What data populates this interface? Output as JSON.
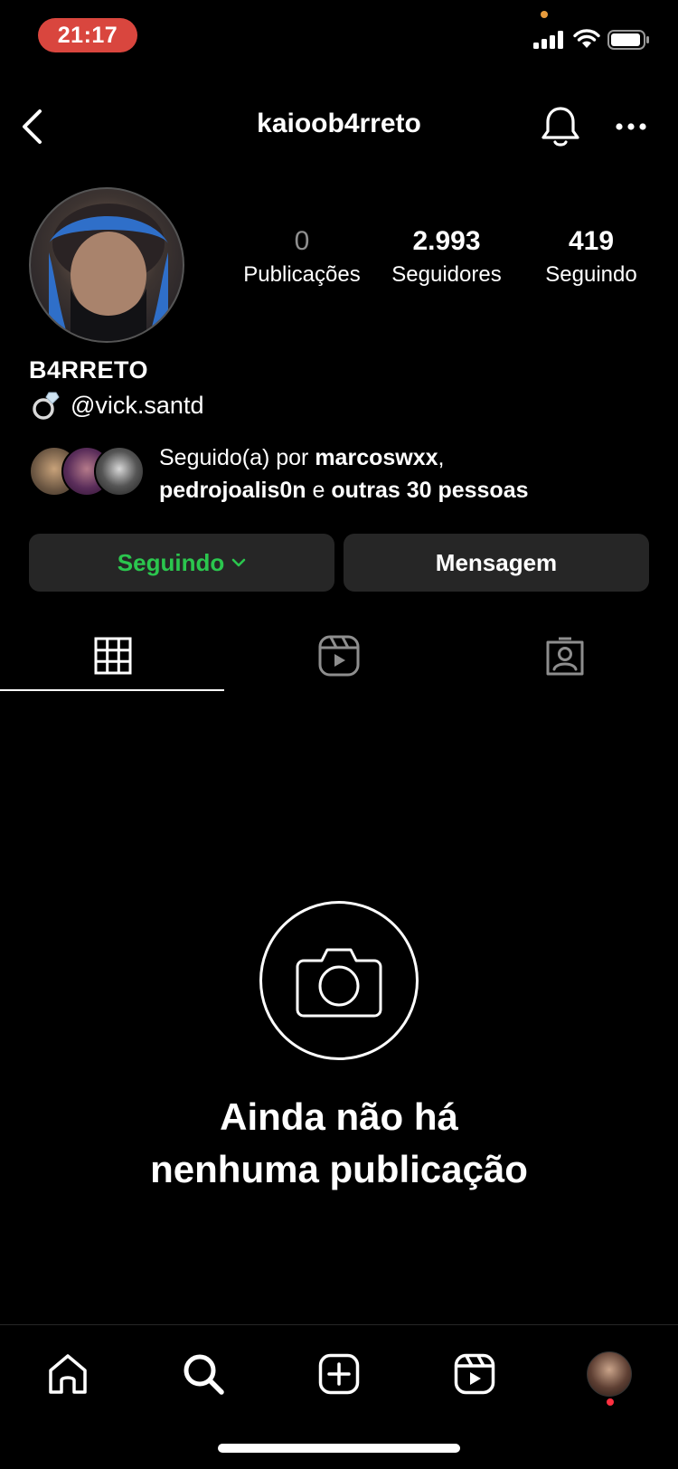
{
  "status_bar": {
    "time": "21:17"
  },
  "header": {
    "username": "kaioob4rreto"
  },
  "profile": {
    "stats": [
      {
        "value": "0",
        "label": "Publicações"
      },
      {
        "value": "2.993",
        "label": "Seguidores"
      },
      {
        "value": "419",
        "label": "Seguindo"
      }
    ],
    "display_name": "B4RRETO",
    "bio_emoji_icon": "ring-icon",
    "bio_mention": "@vick.santd",
    "followed_by": {
      "prefix": "Seguido(a) por ",
      "user1": "marcoswxx",
      "sep": ",",
      "user2": "pedrojoalis0n",
      "conj": " e ",
      "others": "outras 30 pessoas"
    }
  },
  "buttons": {
    "following_label": "Seguindo",
    "message_label": "Mensagem"
  },
  "tabs": [
    {
      "icon": "grid-icon",
      "active": true
    },
    {
      "icon": "reels-icon",
      "active": false
    },
    {
      "icon": "tagged-icon",
      "active": false
    }
  ],
  "empty_state": {
    "line1": "Ainda não há",
    "line2": "nenhuma publicação"
  },
  "bottom_nav": [
    "home-icon",
    "search-icon",
    "create-icon",
    "reels-icon",
    "profile-avatar"
  ],
  "colors": {
    "following_green": "#2bc64e",
    "time_pill": "#d9463e",
    "button_bg": "#262626",
    "notification_dot": "#ff3040"
  }
}
